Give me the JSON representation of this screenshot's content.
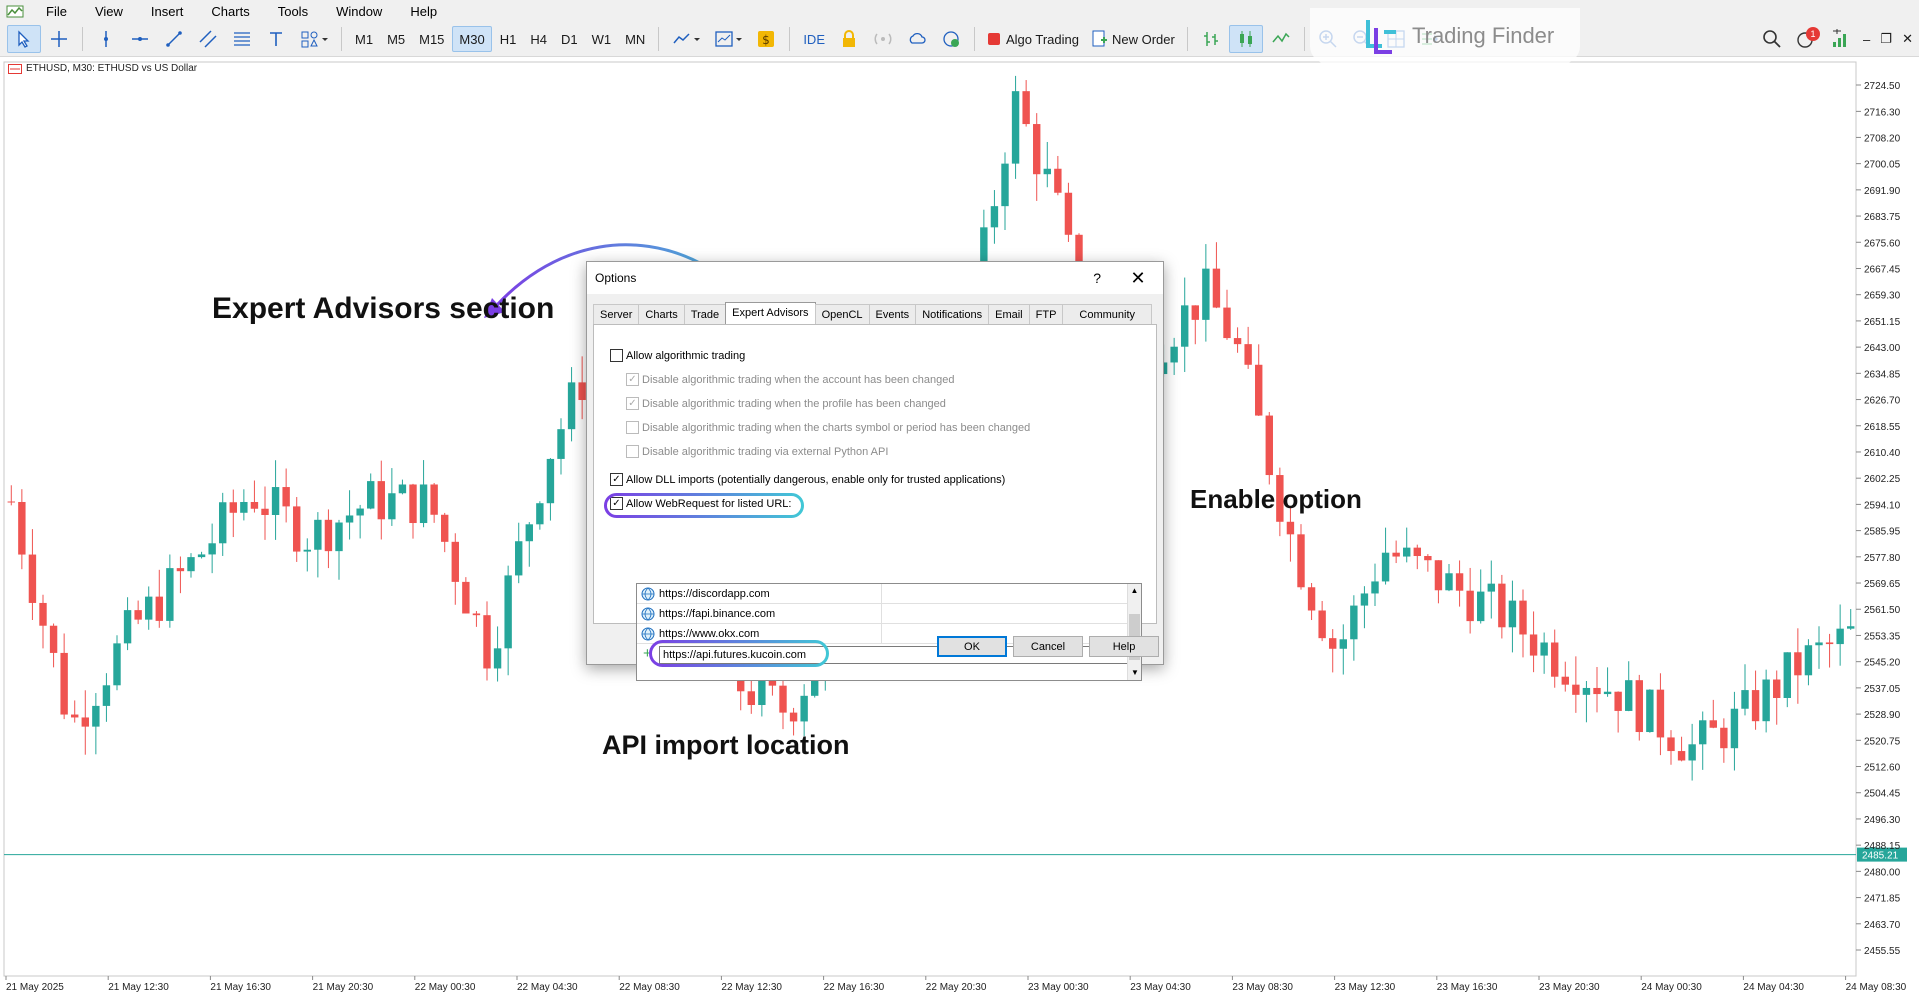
{
  "menu": [
    "File",
    "View",
    "Insert",
    "Charts",
    "Tools",
    "Window",
    "Help"
  ],
  "toolbar": {
    "timeframes": [
      "M1",
      "M5",
      "M15",
      "M30",
      "H1",
      "H4",
      "D1",
      "W1",
      "MN"
    ],
    "active_timeframe": "M30",
    "ide_label": "IDE",
    "algo_trading_label": "Algo Trading",
    "new_order_label": "New Order",
    "notification_count": "1"
  },
  "watermark": {
    "text": "Trading Finder"
  },
  "chart": {
    "title": "ETHUSD, M30:  ETHUSD vs US Dollar",
    "current_price": "2485.21"
  },
  "chart_data": {
    "type": "candlestick",
    "ylim": [
      2450,
      2730
    ],
    "y_ticks": [
      "2724.50",
      "2716.30",
      "2708.20",
      "2700.05",
      "2691.90",
      "2683.75",
      "2675.60",
      "2667.45",
      "2659.30",
      "2651.15",
      "2643.00",
      "2634.85",
      "2626.70",
      "2618.55",
      "2610.40",
      "2602.25",
      "2594.10",
      "2585.95",
      "2577.80",
      "2569.65",
      "2561.50",
      "2553.35",
      "2545.20",
      "2537.05",
      "2528.90",
      "2520.75",
      "2512.60",
      "2504.45",
      "2496.30",
      "2488.15",
      "2480.00",
      "2471.85",
      "2463.70",
      "2455.55"
    ],
    "x_ticks": [
      "21 May 2025",
      "21 May 12:30",
      "21 May 16:30",
      "21 May 20:30",
      "22 May 00:30",
      "22 May 04:30",
      "22 May 08:30",
      "22 May 12:30",
      "22 May 16:30",
      "22 May 20:30",
      "23 May 00:30",
      "23 May 04:30",
      "23 May 08:30",
      "23 May 12:30",
      "23 May 16:30",
      "23 May 20:30",
      "24 May 00:30",
      "24 May 04:30",
      "24 May 08:30"
    ],
    "bull_color": "#26a69a",
    "bear_color": "#ef5350",
    "hline": 2485.21
  },
  "annotations": {
    "expert_advisors": "Expert Advisors section",
    "enable_option": "Enable option",
    "api_import": "API import location"
  },
  "dialog": {
    "title": "Options",
    "help_glyph": "?",
    "close_glyph": "✕",
    "tabs": [
      "Server",
      "Charts",
      "Trade",
      "Expert Advisors",
      "OpenCL",
      "Events",
      "Notifications",
      "Email",
      "FTP",
      "Community"
    ],
    "active_tab": "Expert Advisors",
    "options": [
      {
        "label": "Allow algorithmic trading",
        "checked": false,
        "disabled": false,
        "indent": false
      },
      {
        "label": "Disable algorithmic trading when the account has been changed",
        "checked": true,
        "disabled": true,
        "indent": true
      },
      {
        "label": "Disable algorithmic trading when the profile has been changed",
        "checked": true,
        "disabled": true,
        "indent": true
      },
      {
        "label": "Disable algorithmic trading when the charts symbol or period has been changed",
        "checked": false,
        "disabled": true,
        "indent": true
      },
      {
        "label": "Disable algorithmic trading via external Python API",
        "checked": false,
        "disabled": true,
        "indent": true
      },
      {
        "label": "Allow DLL imports (potentially dangerous, enable only for trusted applications)",
        "checked": true,
        "disabled": false,
        "indent": false
      },
      {
        "label": "Allow WebRequest for listed URL:",
        "checked": true,
        "disabled": false,
        "indent": false
      }
    ],
    "urls": [
      "https://discordapp.com",
      "https://fapi.binance.com",
      "https://www.okx.com"
    ],
    "new_url": "https://api.futures.kucoin.com",
    "buttons": {
      "ok": "OK",
      "cancel": "Cancel",
      "help": "Help"
    }
  }
}
